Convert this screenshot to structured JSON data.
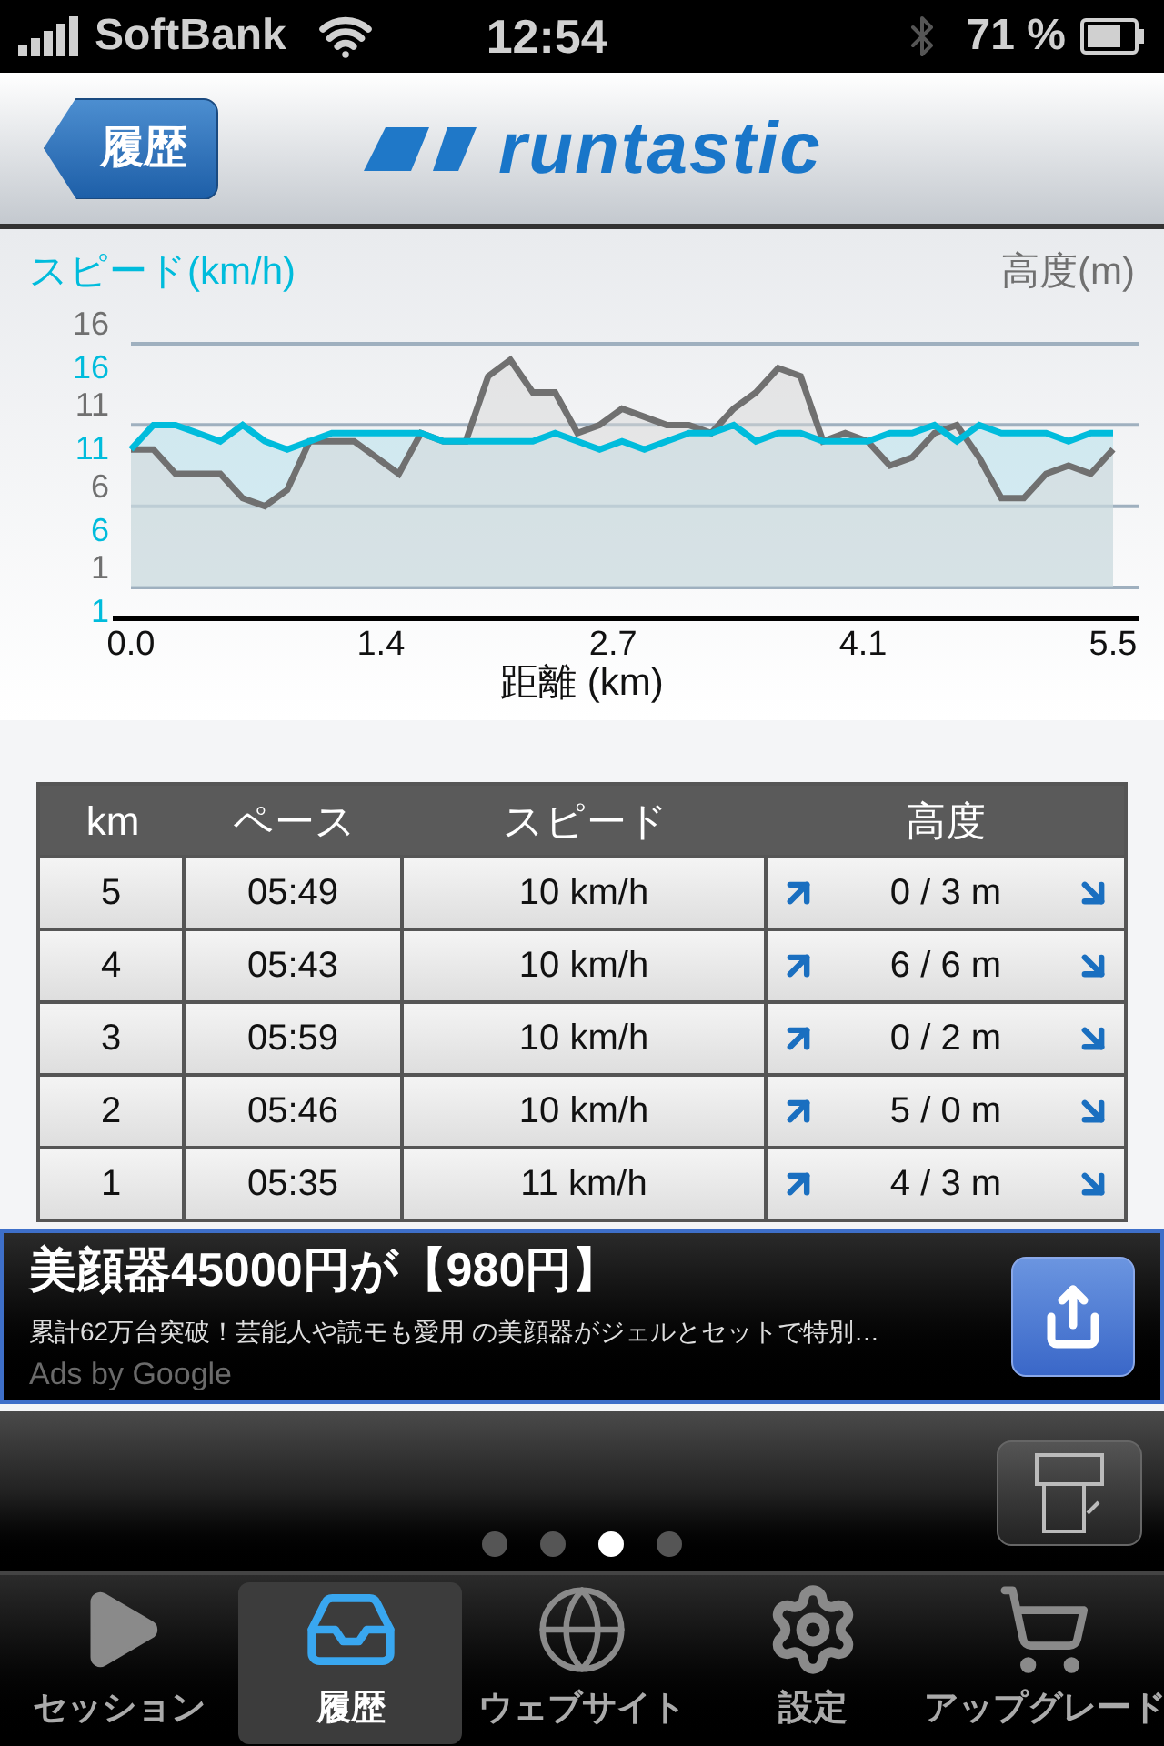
{
  "status_bar": {
    "carrier": "SoftBank",
    "time": "12:54",
    "battery": "71 %"
  },
  "nav": {
    "back": "履歴",
    "logo": "runtastic"
  },
  "chart": {
    "chart_data": {
      "type": "area",
      "grid": true,
      "xlabel": "距離 (km)",
      "xlim": [
        0,
        5.5
      ],
      "ylim": [
        1,
        16
      ],
      "y2ticks": [
        1,
        6,
        11,
        16
      ],
      "y2lim": [
        1,
        16
      ],
      "xticks": [
        {
          "value": 0,
          "label": "0.0"
        },
        {
          "value": 1.4,
          "label": "1.4"
        },
        {
          "value": 2.7,
          "label": "2.7"
        },
        {
          "value": 4.1,
          "label": "4.1"
        },
        {
          "value": 5.5,
          "label": "5.5"
        }
      ],
      "yticks": [
        1,
        6,
        11,
        16
      ],
      "x": [
        0,
        0.125,
        0.25,
        0.375,
        0.5,
        0.625,
        0.75,
        0.875,
        1,
        1.125,
        1.25,
        1.375,
        1.5,
        1.625,
        1.75,
        1.875,
        2,
        2.125,
        2.25,
        2.375,
        2.5,
        2.625,
        2.75,
        2.875,
        3,
        3.125,
        3.25,
        3.375,
        3.5,
        3.625,
        3.75,
        3.875,
        4,
        4.125,
        4.25,
        4.375,
        4.5,
        4.625,
        4.75,
        4.875,
        5,
        5.125,
        5.25,
        5.375,
        5.5
      ],
      "series": [
        {
          "name": "スピード(km/h)",
          "color": "#00bcdc",
          "values": [
            9.5,
            11,
            11,
            10.5,
            10,
            11,
            10,
            9.5,
            10,
            10.5,
            10.5,
            10.5,
            10.5,
            10.5,
            10,
            10,
            10,
            10,
            10,
            10.5,
            10,
            9.5,
            10,
            9.5,
            10,
            10.5,
            10.5,
            11,
            10,
            10.5,
            10.5,
            10,
            10,
            10,
            10.5,
            10.5,
            11,
            10,
            11,
            10.5,
            10.5,
            10.5,
            10,
            10.5,
            10.5
          ]
        },
        {
          "name": "高度(m)",
          "color": "#707070",
          "values": [
            9.5,
            9.5,
            8,
            8,
            8,
            6.5,
            6,
            7,
            10,
            10,
            10,
            9,
            8,
            10.5,
            10,
            10,
            14,
            15,
            13,
            13,
            10.5,
            11,
            12,
            11.5,
            11,
            11,
            10.5,
            12,
            13,
            14.5,
            14,
            10,
            10.5,
            10,
            8.5,
            9,
            10.5,
            11,
            9,
            6.5,
            6.5,
            8,
            8.5,
            8,
            9.5
          ]
        }
      ]
    }
  },
  "table": {
    "columns": [
      "km",
      "ペース",
      "スピード",
      "高度"
    ],
    "rows": [
      {
        "km": "5",
        "pace": "05:49",
        "speed": "10 km/h",
        "altitude": "0 / 3 m"
      },
      {
        "km": "4",
        "pace": "05:43",
        "speed": "10 km/h",
        "altitude": "6 / 6 m"
      },
      {
        "km": "3",
        "pace": "05:59",
        "speed": "10 km/h",
        "altitude": "0 / 2 m"
      },
      {
        "km": "2",
        "pace": "05:46",
        "speed": "10 km/h",
        "altitude": "5 / 0 m"
      },
      {
        "km": "1",
        "pace": "05:35",
        "speed": "11 km/h",
        "altitude": "4 / 3 m"
      }
    ]
  },
  "ad": {
    "title": "美顔器45000円が【980円】",
    "body": "累計62万台突破！芸能人や読モも愛用 の美顔器がジェルとセットで特別…",
    "attribution": "Ads by Google"
  },
  "page_dots": [
    {
      "selected": false
    },
    {
      "selected": false
    },
    {
      "selected": true
    },
    {
      "selected": false
    }
  ],
  "tab_bar": [
    {
      "kind": "play",
      "label": "セッション",
      "selected": false
    },
    {
      "kind": "tray",
      "label": "履歴",
      "selected": true
    },
    {
      "kind": "globe",
      "label": "ウェブサイト",
      "selected": false
    },
    {
      "kind": "gears",
      "label": "設定",
      "selected": false
    },
    {
      "kind": "cart",
      "label": "アップグレード",
      "selected": false
    }
  ]
}
